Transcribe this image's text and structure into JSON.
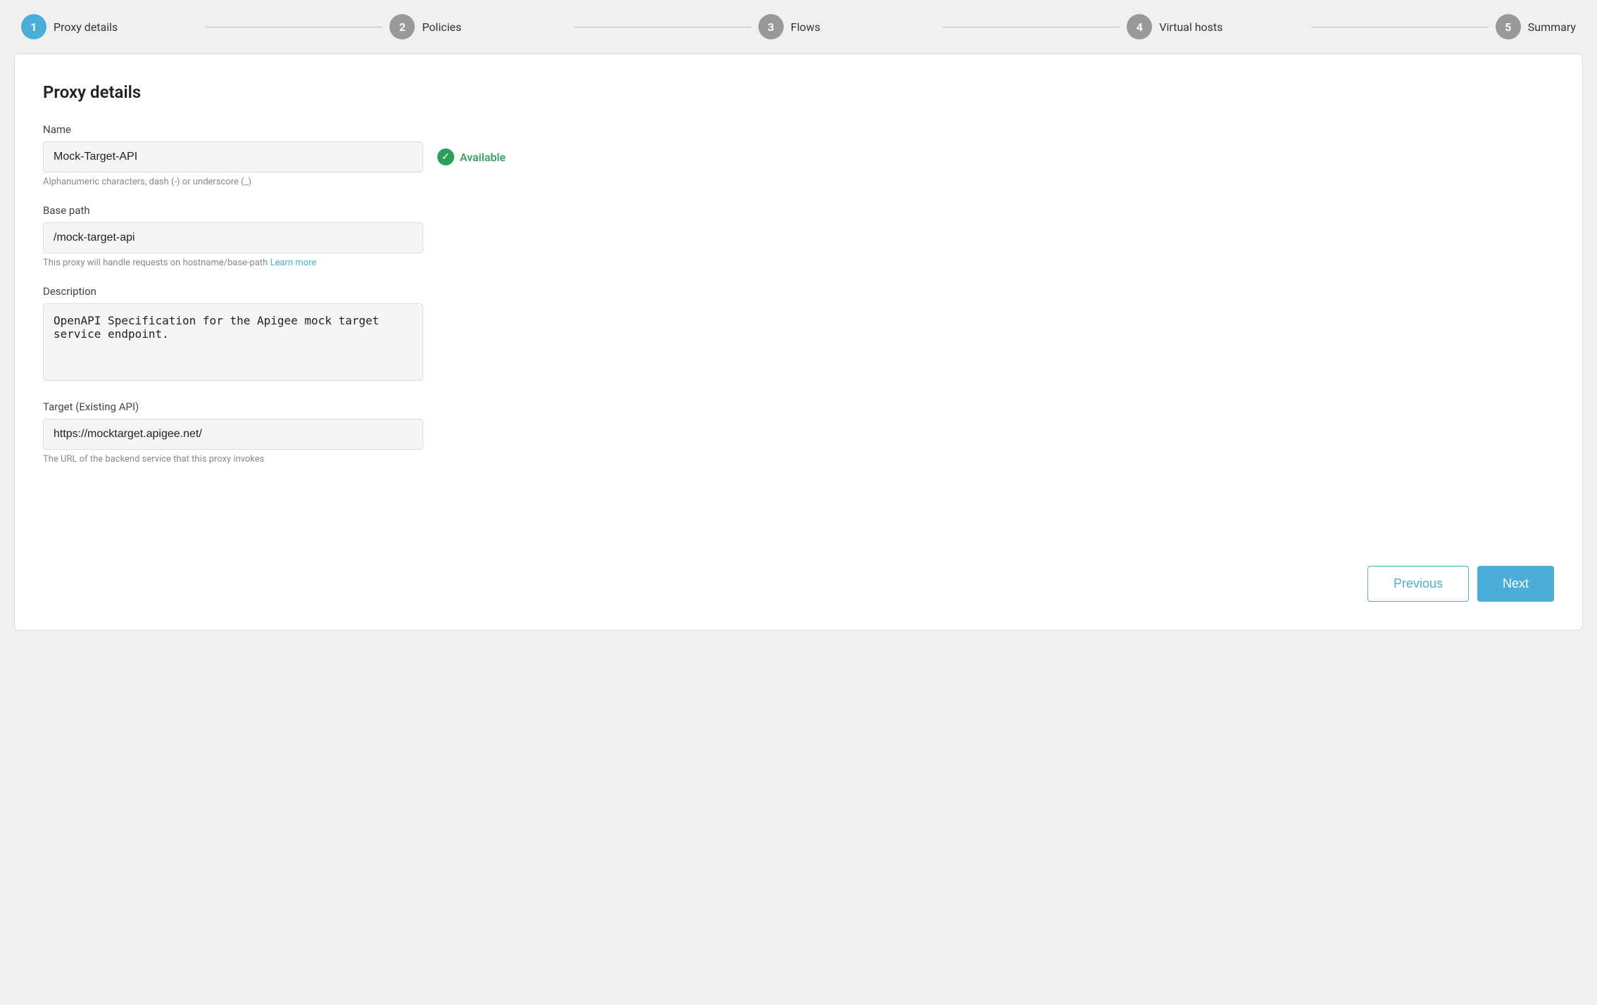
{
  "stepper": {
    "steps": [
      {
        "number": "1",
        "label": "Proxy details",
        "state": "active"
      },
      {
        "number": "2",
        "label": "Policies",
        "state": "inactive"
      },
      {
        "number": "3",
        "label": "Flows",
        "state": "inactive"
      },
      {
        "number": "4",
        "label": "Virtual hosts",
        "state": "inactive"
      },
      {
        "number": "5",
        "label": "Summary",
        "state": "inactive"
      }
    ]
  },
  "form": {
    "title": "Proxy details",
    "name_label": "Name",
    "name_value": "Mock-Target-API",
    "name_hint": "Alphanumeric characters, dash (-) or underscore (_)",
    "available_text": "Available",
    "base_path_label": "Base path",
    "base_path_value": "/mock-target-api",
    "base_path_hint": "This proxy will handle requests on hostname/base-path",
    "base_path_link": "Learn more",
    "description_label": "Description",
    "description_value": "OpenAPI Specification for the Apigee mock target service endpoint.",
    "target_label": "Target (Existing API)",
    "target_value": "https://mocktarget.apigee.net/",
    "target_hint": "The URL of the backend service that this proxy invokes"
  },
  "buttons": {
    "previous_label": "Previous",
    "next_label": "Next"
  }
}
